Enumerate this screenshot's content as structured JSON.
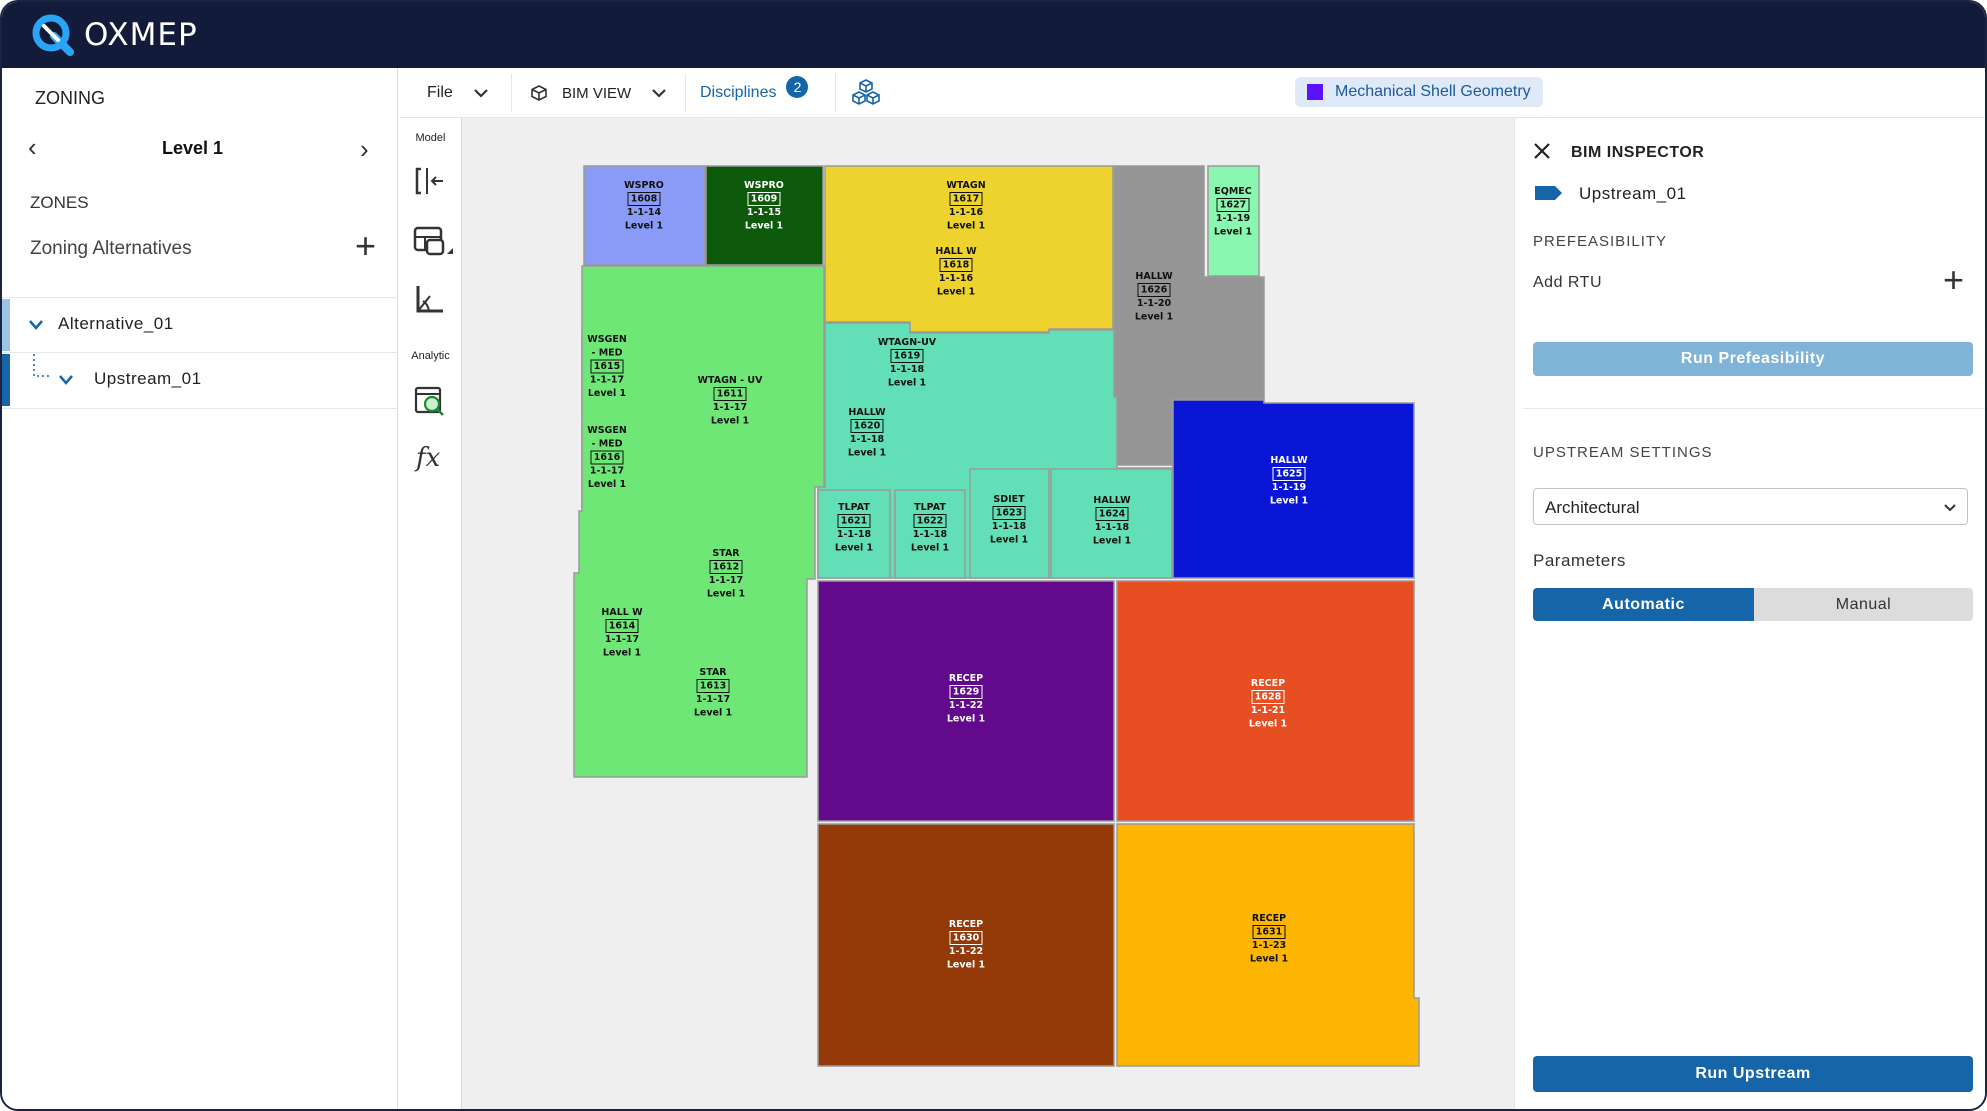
{
  "app": {
    "name": "OXMEP",
    "logo_icon": "oxmep-logo-icon"
  },
  "left_panel": {
    "title": "ZONING",
    "level_label": "Level 1",
    "zones_heading": "ZONES",
    "zoning_alternatives_label": "Zoning Alternatives",
    "tree": [
      {
        "label": "Alternative_01"
      },
      {
        "label": "Upstream_01"
      }
    ]
  },
  "toolstrip": {
    "model_label": "Model",
    "analytic_label": "Analytic"
  },
  "toolbar": {
    "file_label": "File",
    "view_label": "BIM VIEW",
    "disciplines_label": "Disciplines",
    "disciplines_count": "2",
    "geometry_label": "Mechanical Shell Geometry"
  },
  "inspector": {
    "title": "BIM INSPECTOR",
    "item_name": "Upstream_01",
    "prefeasibility_heading": "PREFEASIBILITY",
    "add_rtu_label": "Add RTU",
    "run_prefeasibility_label": "Run Prefeasibility",
    "upstream_settings_heading": "UPSTREAM SETTINGS",
    "dropdown_value": "Architectural",
    "parameters_label": "Parameters",
    "toggle_options": [
      "Automatic",
      "Manual"
    ],
    "toggle_selected": "Automatic",
    "run_upstream_label": "Run Upstream"
  },
  "zones": [
    {
      "name": "WSPRO",
      "number": "1608",
      "code": "1-1-14",
      "level": "Level 1",
      "color": "#8a9bf7",
      "text_color": "#111"
    },
    {
      "name": "WSPRO",
      "number": "1609",
      "code": "1-1-15",
      "level": "Level 1",
      "color": "#0d5a0d",
      "text_color": "#fff"
    },
    {
      "name": "WTAGN",
      "number": "1617",
      "code": "1-1-16",
      "level": "Level 1",
      "color": "#eed32e",
      "text_color": "#111"
    },
    {
      "name": "HALL W",
      "number": "1618",
      "code": "1-1-16",
      "level": "Level 1",
      "color": "#eed32e",
      "text_color": "#111"
    },
    {
      "name": "HALLW",
      "number": "1626",
      "code": "1-1-20",
      "level": "Level 1",
      "color": "#959595",
      "text_color": "#111"
    },
    {
      "name": "EQMEC",
      "number": "1627",
      "code": "1-1-19",
      "level": "Level 1",
      "color": "#8af7b0",
      "text_color": "#111"
    },
    {
      "name": "WSGEN",
      "name2": "- MED",
      "number": "1615",
      "code": "1-1-17",
      "level": "Level 1",
      "color": "#6ee776",
      "text_color": "#111"
    },
    {
      "name": "WSGEN",
      "name2": "- MED",
      "number": "1616",
      "code": "1-1-17",
      "level": "Level 1",
      "color": "#6ee776",
      "text_color": "#111"
    },
    {
      "name": "WTAGN - UV",
      "number": "1611",
      "code": "1-1-17",
      "level": "Level 1",
      "color": "#6ee776",
      "text_color": "#111"
    },
    {
      "name": "STAR",
      "number": "1612",
      "code": "1-1-17",
      "level": "Level 1",
      "color": "#6ee776",
      "text_color": "#111"
    },
    {
      "name": "HALL W",
      "number": "1614",
      "code": "1-1-17",
      "level": "Level 1",
      "color": "#6ee776",
      "text_color": "#111"
    },
    {
      "name": "STAR",
      "number": "1613",
      "code": "1-1-17",
      "level": "Level 1",
      "color": "#6ee776",
      "text_color": "#111"
    },
    {
      "name": "WTAGN-UV",
      "number": "1619",
      "code": "1-1-18",
      "level": "Level 1",
      "color": "#62dfb6",
      "text_color": "#111"
    },
    {
      "name": "HALLW",
      "number": "1620",
      "code": "1-1-18",
      "level": "Level 1",
      "color": "#62dfb6",
      "text_color": "#111"
    },
    {
      "name": "TLPAT",
      "number": "1621",
      "code": "1-1-18",
      "level": "Level 1",
      "color": "#62dfb6",
      "text_color": "#111"
    },
    {
      "name": "TLPAT",
      "number": "1622",
      "code": "1-1-18",
      "level": "Level 1",
      "color": "#62dfb6",
      "text_color": "#111"
    },
    {
      "name": "SDIET",
      "number": "1623",
      "code": "1-1-18",
      "level": "Level 1",
      "color": "#62dfb6",
      "text_color": "#111"
    },
    {
      "name": "HALLW",
      "number": "1624",
      "code": "1-1-18",
      "level": "Level 1",
      "color": "#62dfb6",
      "text_color": "#111"
    },
    {
      "name": "HALLW",
      "number": "1625",
      "code": "1-1-19",
      "level": "Level 1",
      "color": "#0a16d6",
      "text_color": "#fff"
    },
    {
      "name": "RECEP",
      "number": "1629",
      "code": "1-1-22",
      "level": "Level 1",
      "color": "#62098c",
      "text_color": "#fff"
    },
    {
      "name": "RECEP",
      "number": "1628",
      "code": "1-1-21",
      "level": "Level 1",
      "color": "#e74e22",
      "text_color": "#fff"
    },
    {
      "name": "RECEP",
      "number": "1630",
      "code": "1-1-22",
      "level": "Level 1",
      "color": "#933a08",
      "text_color": "#fff"
    },
    {
      "name": "RECEP",
      "number": "1631",
      "code": "1-1-23",
      "level": "Level 1",
      "color": "#fcb500",
      "text_color": "#111"
    }
  ]
}
